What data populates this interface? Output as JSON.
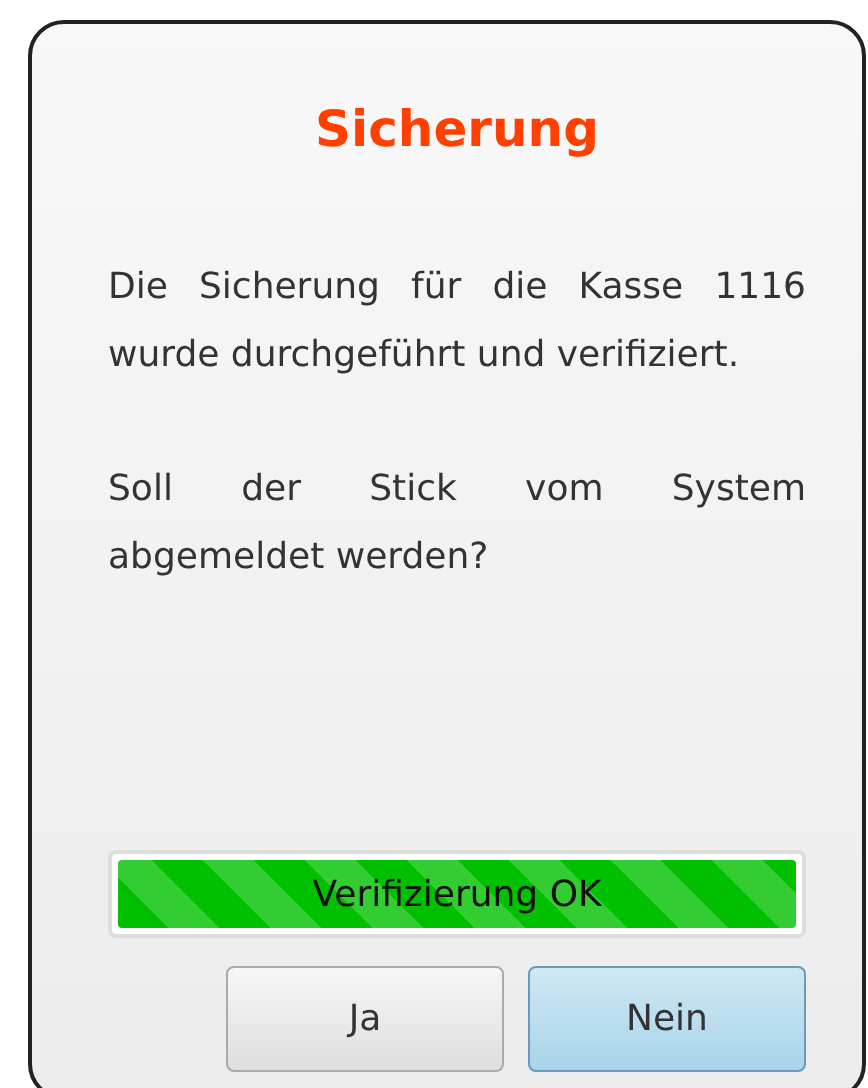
{
  "dialog": {
    "title": "Sicherung",
    "paragraphs": [
      "Die Sicherung für die Kasse 1116 wurde durchgeführt und verifiziert.",
      "Soll der Stick vom System abgemeldet werden?"
    ],
    "progress": {
      "level": 1,
      "label": "Verifizierung OK"
    },
    "buttons": [
      {
        "label": "Ja",
        "default": false
      },
      {
        "label": "Nein",
        "default": true
      }
    ]
  }
}
